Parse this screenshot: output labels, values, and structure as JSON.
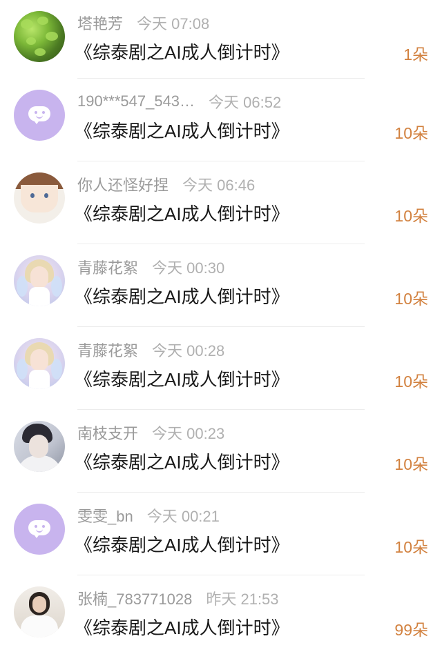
{
  "colors": {
    "accent_count": "#d2813f",
    "name_gray": "#9a9a9a",
    "time_gray": "#b0b0b0",
    "title_black": "#1a1a1a",
    "default_avatar_purple": "#c8b4ee"
  },
  "items": [
    {
      "username": "塔艳芳",
      "time": "今天 07:08",
      "title": "《综泰剧之AI成人倒计时》",
      "count": "1朵",
      "avatar": "leaves-photo"
    },
    {
      "username": "190***547_543…",
      "time": "今天 06:52",
      "title": "《综泰剧之AI成人倒计时》",
      "count": "10朵",
      "avatar": "default-chat-icon"
    },
    {
      "username": "你人还怪好捏",
      "time": "今天 06:46",
      "title": "《综泰剧之AI成人倒计时》",
      "count": "10朵",
      "avatar": "anime-boy-photo"
    },
    {
      "username": "青藤花絮",
      "time": "今天 00:30",
      "title": "《综泰剧之AI成人倒计时》",
      "count": "10朵",
      "avatar": "fairy-photo"
    },
    {
      "username": "青藤花絮",
      "time": "今天 00:28",
      "title": "《综泰剧之AI成人倒计时》",
      "count": "10朵",
      "avatar": "fairy-photo"
    },
    {
      "username": "南枝支开",
      "time": "今天 00:23",
      "title": "《综泰剧之AI成人倒计时》",
      "count": "10朵",
      "avatar": "dark-hair-photo"
    },
    {
      "username": "雯雯_bn",
      "time": "今天 00:21",
      "title": "《综泰剧之AI成人倒计时》",
      "count": "10朵",
      "avatar": "default-chat-icon"
    },
    {
      "username": "张楠_783771028",
      "time": "昨天 21:53",
      "title": "《综泰剧之AI成人倒计时》",
      "count": "99朵",
      "avatar": "girl-photo"
    }
  ]
}
